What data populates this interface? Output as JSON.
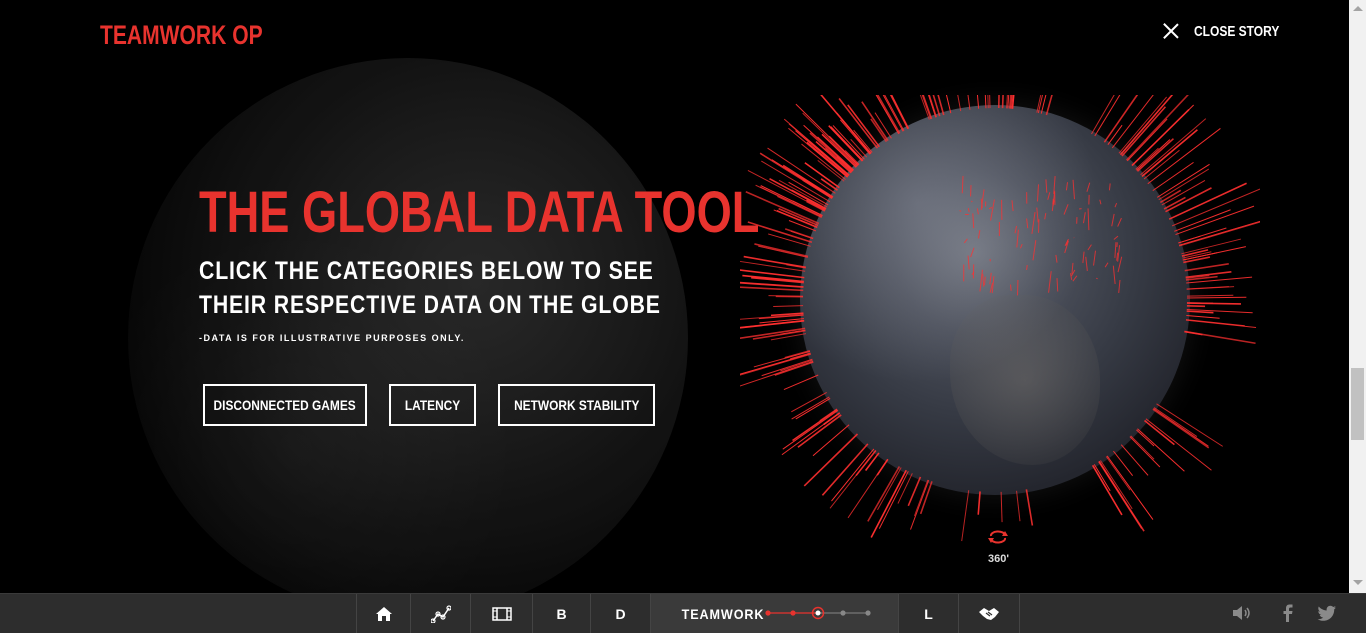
{
  "header": {
    "logo": "TEAMWORK OP",
    "close_label": "CLOSE STORY"
  },
  "main": {
    "title": "THE GLOBAL DATA TOOL",
    "subtitle": "CLICK THE CATEGORIES BELOW TO SEE THEIR RESPECTIVE DATA ON THE GLOBE",
    "disclaimer": "-DATA IS FOR ILLUSTRATIVE PURPOSES ONLY.",
    "buttons": [
      "DISCONNECTED GAMES",
      "LATENCY",
      "NETWORK STABILITY"
    ]
  },
  "globe": {
    "rotate_label": "360'"
  },
  "footer": {
    "nav": [
      "B",
      "D",
      "TEAMWORK",
      "L"
    ],
    "progress": {
      "steps": 5,
      "current": 3
    }
  },
  "colors": {
    "accent": "#e8332e",
    "footer_bg": "#2d2d2d"
  },
  "icons": [
    "close-icon",
    "home-icon",
    "graph-icon",
    "film-icon",
    "handshake-icon",
    "rotate-icon",
    "volume-icon",
    "facebook-icon",
    "twitter-icon"
  ]
}
